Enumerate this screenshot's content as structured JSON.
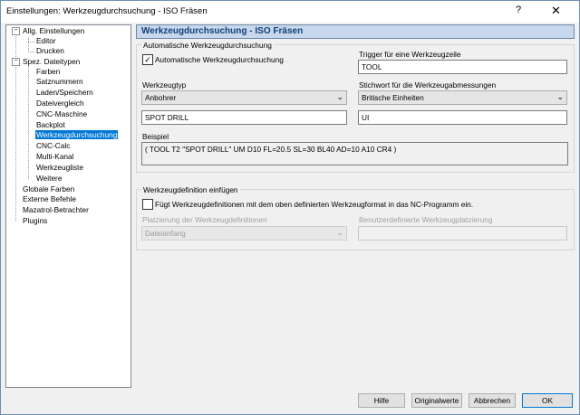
{
  "window": {
    "title": "Einstellungen: Werkzeugdurchsuchung - ISO Fräsen",
    "help": "?",
    "close": "✕"
  },
  "tree": {
    "allg": "Allg. Einstellungen",
    "editor": "Editor",
    "drucken": "Drucken",
    "spez": "Spez. Dateitypen",
    "farben": "Farben",
    "satznummern": "Satznummern",
    "laden": "Laden/Speichern",
    "dateivergleich": "Dateivergleich",
    "cnc_maschine": "CNC-Maschine",
    "backplot": "Backplot",
    "werkzeugdurchsuchung": "Werkzeugdurchsuchung",
    "cnc_calc": "CNC-Calc",
    "multi_kanal": "Multi-Kanal",
    "werkzeugliste": "Werkzeugliste",
    "weitere": "Weitere",
    "globale_farben": "Globale Farben",
    "externe_befehle": "Externe Befehle",
    "mazatrol": "Mazatrol-Betrachter",
    "plugins": "Plugins",
    "minus": "−"
  },
  "header": {
    "title": "Werkzeugdurchsuchung - ISO Fräsen"
  },
  "auto": {
    "group_label": "Automatische Werkzeugdurchsuchung",
    "checkbox_label": "Automatische Werkzeugdurchsuchung",
    "checked_mark": "✓",
    "trigger_label": "Trigger für eine Werkzeugzeile",
    "trigger_value": "TOOL",
    "type_label": "Werkzeugtyp",
    "type_value": "Anbohrer",
    "keyword_label": "Stichwort für die Werkzeugabmessungen",
    "keyword_value": "Britische Einheiten",
    "type_text": "SPOT DRILL",
    "keyword_text": "UI",
    "example_label": "Beispiel",
    "example_text": "( TOOL T2 \"SPOT DRILL\" UM D10 FL=20.5 SL=30 BL40 AD=10 A10 CR4 )"
  },
  "def": {
    "group_label": "Werkzeugdefinition einfügen",
    "checkbox_label": "Fügt Werkzeugdefinitionen mit dem oben definierten Werkzeugformat in das NC-Programm ein.",
    "placement_label": "Platzierung der Werkzeugdefinitionen",
    "placement_value": "Dateianfang",
    "custom_label": "Benutzerdefinierte Werkzeugplatzierung",
    "custom_value": ""
  },
  "buttons": {
    "help": "Hilfe",
    "defaults": "Originalwerte",
    "cancel": "Abbrechen",
    "ok": "OK"
  },
  "combo_arrow": "⌄"
}
